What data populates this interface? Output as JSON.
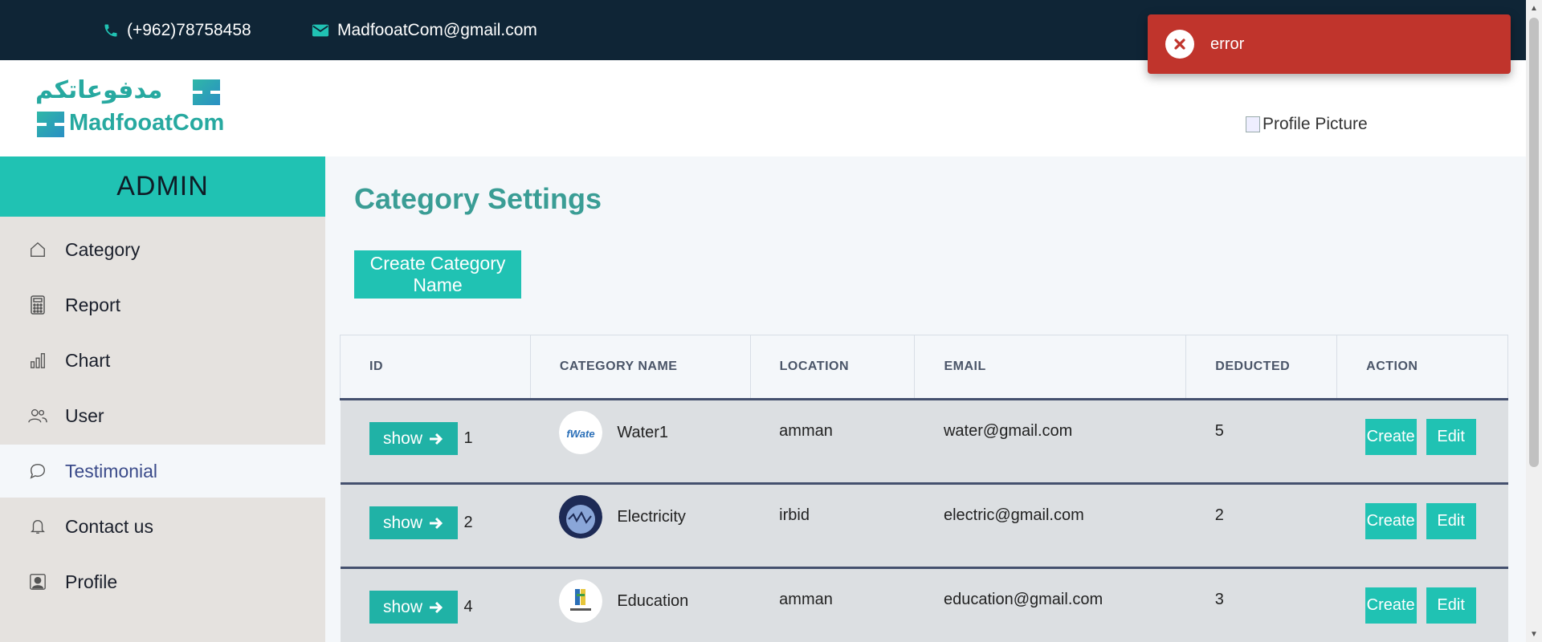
{
  "topbar": {
    "phone": "(+962)78758458",
    "email": "MadfooatCom@gmail.com"
  },
  "logo": {
    "arabic": "مدفوعاتكم",
    "english": "MadfooatCom"
  },
  "header": {
    "profile_alt": "Profile Picture"
  },
  "sidebar": {
    "heading": "ADMIN",
    "items": [
      {
        "label": "Category",
        "icon": "home-icon",
        "active": false
      },
      {
        "label": "Report",
        "icon": "calculator-icon",
        "active": false
      },
      {
        "label": "Chart",
        "icon": "bar-chart-icon",
        "active": false
      },
      {
        "label": "User",
        "icon": "users-icon",
        "active": false
      },
      {
        "label": "Testimonial",
        "icon": "chat-icon",
        "active": true
      },
      {
        "label": "Contact us",
        "icon": "bell-icon",
        "active": false
      },
      {
        "label": "Profile",
        "icon": "profile-icon",
        "active": false
      }
    ]
  },
  "main": {
    "title": "Category Settings",
    "create_button": "Create Category Name"
  },
  "table": {
    "columns": [
      "ID",
      "CATEGORY NAME",
      "LOCATION",
      "EMAIL",
      "DEDUCTED",
      "ACTION"
    ],
    "show_label": "show",
    "create_label": "Create",
    "edit_label": "Edit",
    "rows": [
      {
        "id": "1",
        "name": "Water1",
        "location": "amman",
        "email": "water@gmail.com",
        "deducted": "5"
      },
      {
        "id": "2",
        "name": "Electricity",
        "location": "irbid",
        "email": "electric@gmail.com",
        "deducted": "2"
      },
      {
        "id": "4",
        "name": "Education",
        "location": "amman",
        "email": "education@gmail.com",
        "deducted": "3"
      }
    ]
  },
  "toast": {
    "message": "error"
  },
  "colors": {
    "teal": "#20c2b3",
    "dark_navy": "#0f2536",
    "error_red": "#c0342c",
    "title_teal": "#3a9d95"
  }
}
